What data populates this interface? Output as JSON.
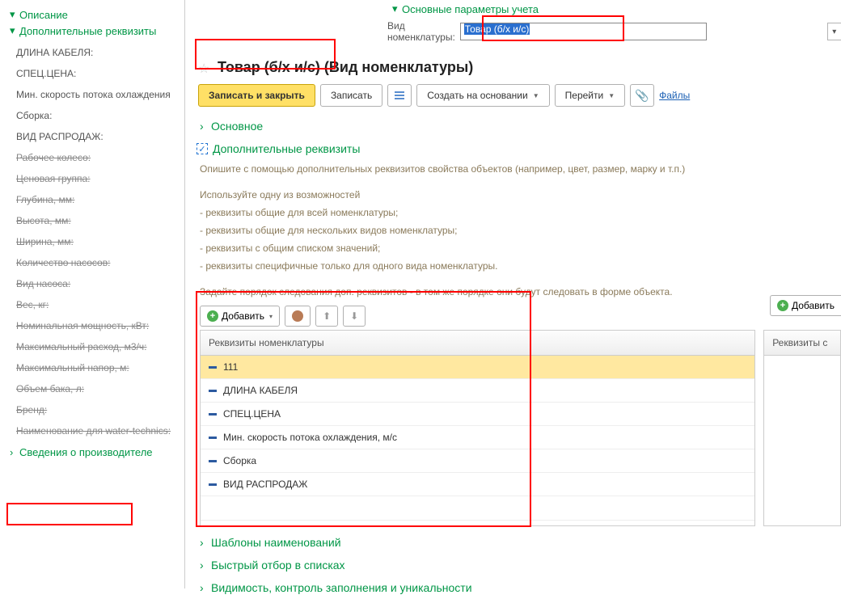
{
  "left": {
    "opisanie": "Описание",
    "dop": "Дополнительные реквизиты",
    "svedeniya": "Сведения о производителе",
    "props": [
      {
        "label": "ДЛИНА КАБЕЛЯ:",
        "strike": false
      },
      {
        "label": "СПЕЦ.ЦЕНА:",
        "strike": false
      },
      {
        "label": "Мин. скорость потока охлаждения",
        "strike": false
      },
      {
        "label": "Сборка:",
        "strike": false
      },
      {
        "label": "ВИД РАСПРОДАЖ:",
        "strike": false
      },
      {
        "label": "Рабочее колесо:",
        "strike": true
      },
      {
        "label": "Ценовая группа:",
        "strike": true
      },
      {
        "label": "Глубина, мм:",
        "strike": true
      },
      {
        "label": "Высота, мм:",
        "strike": true
      },
      {
        "label": "Ширина, мм:",
        "strike": true
      },
      {
        "label": "Количество насосов:",
        "strike": true
      },
      {
        "label": "Вид насоса:",
        "strike": true
      },
      {
        "label": "Вес, кг:",
        "strike": true
      },
      {
        "label": "Номинальная мощность, кВт:",
        "strike": true
      },
      {
        "label": "Максимальный расход, м3/ч:",
        "strike": true
      },
      {
        "label": "Максимальный напор, м:",
        "strike": true
      },
      {
        "label": "Объем бака, л:",
        "strike": true
      },
      {
        "label": "Бренд:",
        "strike": true
      },
      {
        "label": "Наименование для water-technics:",
        "strike": true
      }
    ]
  },
  "top": {
    "osnovnye": "Основные параметры учета",
    "vid_label": "Вид номенклатуры:",
    "vid_value": "Товар (б/х и/с)"
  },
  "title": "Товар (б/х и/с) (Вид номенклатуры)",
  "toolbar": {
    "save_close": "Записать и закрыть",
    "save": "Записать",
    "create_based": "Создать на основании",
    "goto": "Перейти",
    "files": "Файлы"
  },
  "sections": {
    "osnovnoe": "Основное",
    "dop": "Дополнительные реквизиты",
    "shablony": "Шаблоны наименований",
    "bystryj": "Быстрый отбор в списках",
    "vidimost": "Видимость, контроль заполнения и уникальности"
  },
  "desc": {
    "l1": "Опишите с помощью дополнительных реквизитов свойства объектов (например, цвет, размер, марку и т.п.)",
    "l2": "Используйте одну из возможностей",
    "b1": "- реквизиты общие для всей номенклатуры;",
    "b2": "- реквизиты общие для нескольких видов номенклатуры;",
    "b3": "- реквизиты с общим списком значений;",
    "b4": "- реквизиты специфичные только для одного вида номенклатуры.",
    "l3": "Задайте порядок следования доп. реквизитов - в том же порядке они будут следовать в форме объекта."
  },
  "tbl_toolbar": {
    "add": "Добавить",
    "add2": "Добавить"
  },
  "table_left": {
    "header": "Реквизиты номенклатуры",
    "rows": [
      "111",
      "ДЛИНА КАБЕЛЯ",
      "СПЕЦ.ЦЕНА",
      "Мин. скорость потока охлаждения, м/с",
      "Сборка",
      "ВИД РАСПРОДАЖ"
    ]
  },
  "table_right": {
    "header": "Реквизиты с"
  }
}
